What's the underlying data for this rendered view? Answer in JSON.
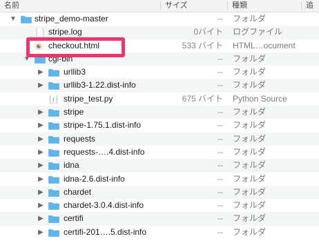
{
  "header": {
    "name": "名前",
    "size": "サイズ",
    "kind": "種類",
    "extra": "追"
  },
  "rows": [
    {
      "level": 0,
      "type": "folder",
      "expanded": true,
      "name": "stripe_demo-master",
      "size": "--",
      "kind": "フォルダ"
    },
    {
      "level": 1,
      "type": "file",
      "name": "stripe.log",
      "size": "0バイト",
      "kind": "ログファイル"
    },
    {
      "level": 1,
      "type": "html",
      "name": "checkout.html",
      "size": "533 バイト",
      "kind": "HTML…ocument",
      "highlighted": true
    },
    {
      "level": 1,
      "type": "folder",
      "expanded": true,
      "name": "cgi-bin",
      "size": "--",
      "kind": "フォルダ"
    },
    {
      "level": 2,
      "type": "folder",
      "expanded": false,
      "name": "urllib3",
      "size": "--",
      "kind": "フォルダ"
    },
    {
      "level": 2,
      "type": "folder",
      "expanded": false,
      "name": "urllib3-1.22.dist-info",
      "size": "--",
      "kind": "フォルダ"
    },
    {
      "level": 2,
      "type": "py",
      "name": "stripe_test.py",
      "size": "675 バイト",
      "kind": "Python Source"
    },
    {
      "level": 2,
      "type": "folder",
      "expanded": false,
      "name": "stripe",
      "size": "--",
      "kind": "フォルダ"
    },
    {
      "level": 2,
      "type": "folder",
      "expanded": false,
      "name": "stripe-1.75.1.dist-info",
      "size": "--",
      "kind": "フォルダ"
    },
    {
      "level": 2,
      "type": "folder",
      "expanded": false,
      "name": "requests",
      "size": "--",
      "kind": "フォルダ"
    },
    {
      "level": 2,
      "type": "folder",
      "expanded": false,
      "name": "requests-….4.dist-info",
      "size": "--",
      "kind": "フォルダ"
    },
    {
      "level": 2,
      "type": "folder",
      "expanded": false,
      "name": "idna",
      "size": "--",
      "kind": "フォルダ"
    },
    {
      "level": 2,
      "type": "folder",
      "expanded": false,
      "name": "idna-2.6.dist-info",
      "size": "--",
      "kind": "フォルダ"
    },
    {
      "level": 2,
      "type": "folder",
      "expanded": false,
      "name": "chardet",
      "size": "--",
      "kind": "フォルダ"
    },
    {
      "level": 2,
      "type": "folder",
      "expanded": false,
      "name": "chardet-3.0.4.dist-info",
      "size": "--",
      "kind": "フォルダ"
    },
    {
      "level": 2,
      "type": "folder",
      "expanded": false,
      "name": "certifi",
      "size": "--",
      "kind": "フォルダ"
    },
    {
      "level": 2,
      "type": "folder",
      "expanded": false,
      "name": "certifi-201….5.dist-info",
      "size": "--",
      "kind": "フォルダ"
    }
  ],
  "colors": {
    "folder": "#5db5ec",
    "highlight": "#f0346e"
  }
}
